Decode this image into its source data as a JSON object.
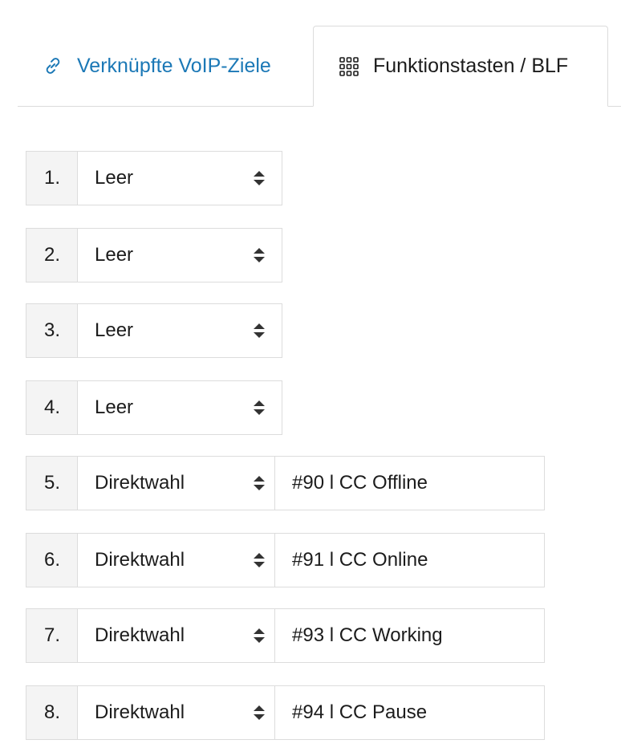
{
  "tabs": {
    "linked_label": "Verknüpfte VoIP-Ziele",
    "linked_icon": "link-icon",
    "function_label": "Funktionstasten / BLF",
    "function_icon": "grid-icon",
    "active": "function"
  },
  "colors": {
    "link": "#1b78b6",
    "border": "#dcdcdc",
    "number_bg": "#f4f4f4",
    "text": "#1c1c1c"
  },
  "keys": [
    {
      "number": "1.",
      "type": "Leer",
      "target": null
    },
    {
      "number": "2.",
      "type": "Leer",
      "target": null
    },
    {
      "number": "3.",
      "type": "Leer",
      "target": null
    },
    {
      "number": "4.",
      "type": "Leer",
      "target": null
    },
    {
      "number": "5.",
      "type": "Direktwahl",
      "target": "#90 l CC Offline"
    },
    {
      "number": "6.",
      "type": "Direktwahl",
      "target": "#91 l CC Online"
    },
    {
      "number": "7.",
      "type": "Direktwahl",
      "target": "#93 l CC Working"
    },
    {
      "number": "8.",
      "type": "Direktwahl",
      "target": "#94 l CC Pause"
    }
  ]
}
